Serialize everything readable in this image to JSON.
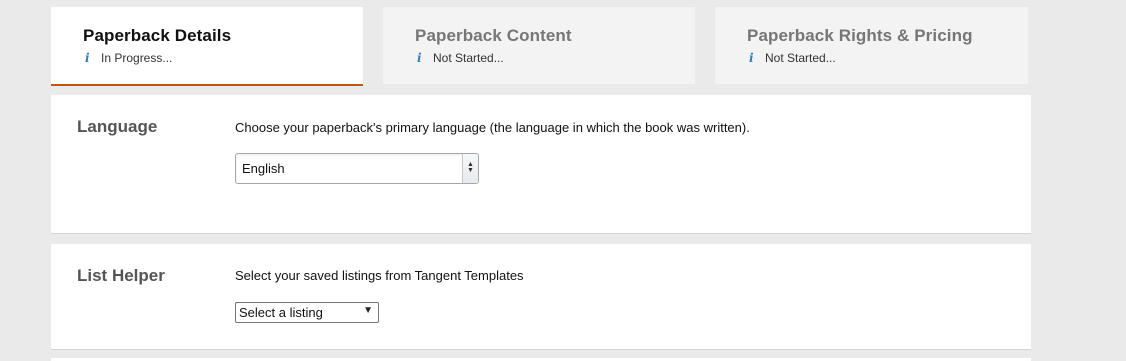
{
  "tabs": [
    {
      "title": "Paperback Details",
      "status": "In Progress..."
    },
    {
      "title": "Paperback Content",
      "status": "Not Started..."
    },
    {
      "title": "Paperback Rights & Pricing",
      "status": "Not Started..."
    }
  ],
  "active_tab": 0,
  "language": {
    "title": "Language",
    "description": "Choose your paperback's primary language (the language in which the book was written).",
    "selected": "English"
  },
  "list_helper": {
    "title": "List Helper",
    "description": "Select your saved listings from Tangent Templates",
    "selected": "Select a listing"
  },
  "icons": {
    "status": "info-icon",
    "language_select": "up-down-arrows-icon",
    "listing_select": "caret-down-icon"
  },
  "colors": {
    "active_tab_underline": "#c45500",
    "info_icon": "#2f7fb0",
    "background": "#eaeaea"
  }
}
